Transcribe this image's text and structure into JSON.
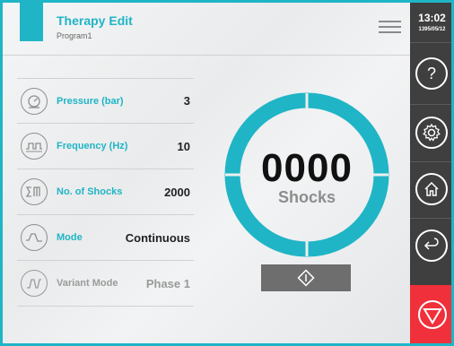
{
  "header": {
    "title": "Therapy Edit",
    "subtitle": "Program1"
  },
  "params": [
    {
      "label": "Pressure (bar)",
      "value": "3",
      "icon": "pressure-gauge-icon"
    },
    {
      "label": "Frequency (Hz)",
      "value": "10",
      "icon": "frequency-wave-icon"
    },
    {
      "label": "No. of Shocks",
      "value": "2000",
      "icon": "shock-count-icon"
    },
    {
      "label": "Mode",
      "value": "Continuous",
      "icon": "mode-wave-icon"
    },
    {
      "label": "Variant Mode",
      "value": "Phase 1",
      "icon": "variant-mode-icon"
    }
  ],
  "counter": {
    "value": "0000",
    "label": "Shocks"
  },
  "status": {
    "time": "13:02",
    "date": "1395/05/12"
  },
  "colors": {
    "accent": "#1fb5c6",
    "sidebar": "#3f3f3f",
    "stop": "#f0303a",
    "start_button": "#6e6e6e"
  },
  "sidebar_icons": [
    "help-icon",
    "settings-gear-icon",
    "home-icon",
    "back-arrow-icon",
    "stop-icon"
  ]
}
